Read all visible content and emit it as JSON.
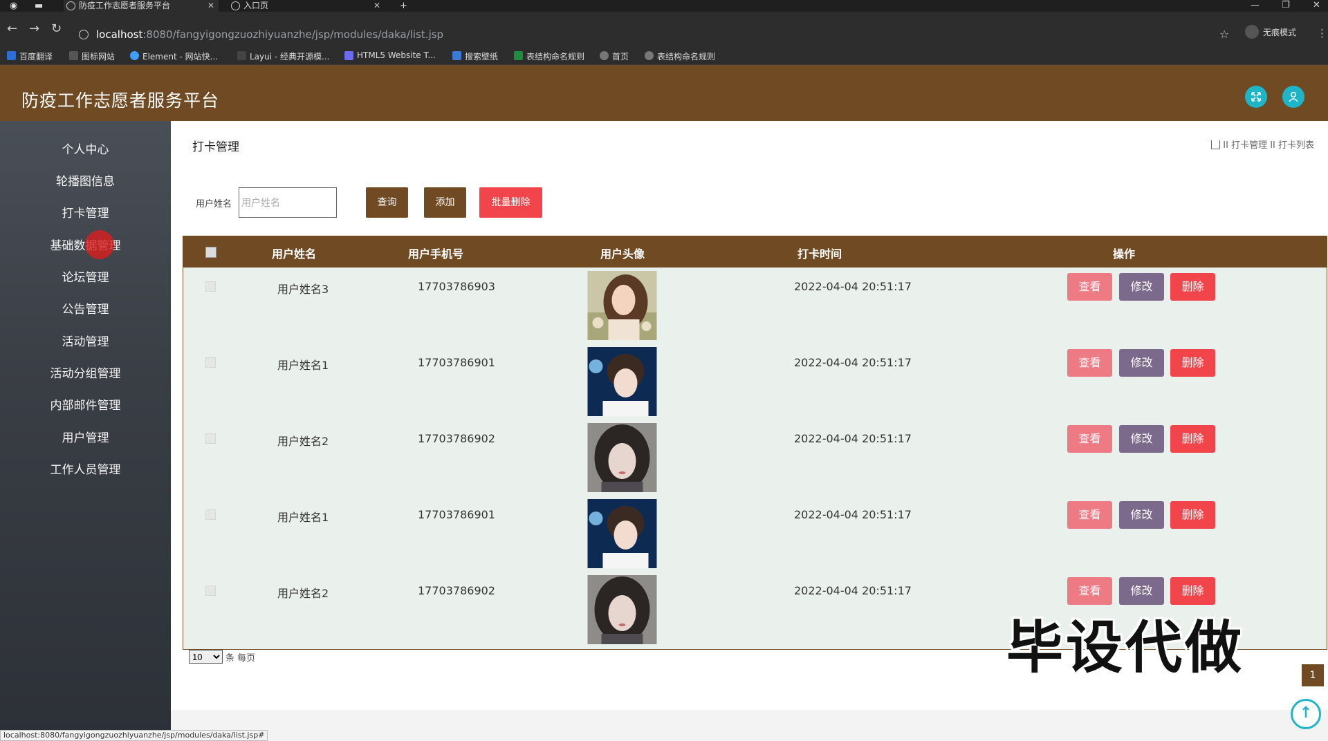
{
  "browser": {
    "tabs": [
      {
        "title": "防疫工作志愿者服务平台"
      },
      {
        "title": "入口页"
      }
    ],
    "url_host": "localhost",
    "url_path": ":8080/fangyigongzuozhiyuanzhe/jsp/modules/daka/list.jsp",
    "incognito_label": "无痕模式",
    "bookmarks": [
      "百度翻译",
      "图标网站",
      "Element - 网站快...",
      "Layui - 经典开源模...",
      "HTML5 Website T...",
      "搜索壁纸",
      "表结构命名规则",
      "首页",
      "表结构命名规则"
    ],
    "status_url": "localhost:8080/fangyigongzuozhiyuanzhe/jsp/modules/daka/list.jsp#"
  },
  "app": {
    "title": "防疫工作志愿者服务平台"
  },
  "sidebar": {
    "items": [
      "个人中心",
      "轮播图信息",
      "打卡管理",
      "基础数据管理",
      "论坛管理",
      "公告管理",
      "活动管理",
      "活动分组管理",
      "内部邮件管理",
      "用户管理",
      "工作人员管理"
    ]
  },
  "page": {
    "title": "打卡管理",
    "breadcrumb": "II 打卡管理 II 打卡列表"
  },
  "search": {
    "label": "用户姓名",
    "placeholder": "用户姓名",
    "value": "",
    "query_label": "查询",
    "add_label": "添加",
    "batch_delete_label": "批量删除"
  },
  "table": {
    "headers": {
      "name": "用户姓名",
      "phone": "用户手机号",
      "avatar": "用户头像",
      "time": "打卡时间",
      "actions": "操作"
    },
    "rows": [
      {
        "name": "用户姓名3",
        "phone": "17703786903",
        "time": "2022-04-04 20:51:17",
        "avatar": "avatar-girl-flowers"
      },
      {
        "name": "用户姓名1",
        "phone": "17703786901",
        "time": "2022-04-04 20:51:17",
        "avatar": "avatar-boy-blue"
      },
      {
        "name": "用户姓名2",
        "phone": "17703786902",
        "time": "2022-04-04 20:51:17",
        "avatar": "avatar-girl-dark"
      },
      {
        "name": "用户姓名1",
        "phone": "17703786901",
        "time": "2022-04-04 20:51:17",
        "avatar": "avatar-boy-blue"
      },
      {
        "name": "用户姓名2",
        "phone": "17703786902",
        "time": "2022-04-04 20:51:17",
        "avatar": "avatar-girl-dark"
      }
    ],
    "view_label": "查看",
    "edit_label": "修改",
    "delete_label": "删除"
  },
  "pagination": {
    "page_size": "10",
    "page_size_label": "条 每页",
    "current_page": "1"
  },
  "overlay": {
    "watermark": "毕设代做"
  },
  "colors": {
    "brand": "#6f4a23",
    "danger": "#f2454b",
    "view": "#ee7a83",
    "edit": "#7c6a8c",
    "accent": "#1fb5c8"
  }
}
